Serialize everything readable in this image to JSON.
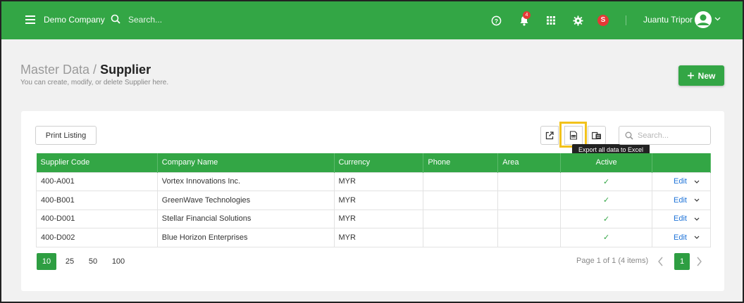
{
  "topbar": {
    "company": "Demo Company",
    "search_placeholder": "Search...",
    "notification_count": "4",
    "avatar_letter": "S",
    "username": "Juantu Tripor"
  },
  "colors": {
    "brand": "#33a645",
    "link": "#1e73d8",
    "highlight": "#f2c21b"
  },
  "page": {
    "breadcrumb_parent": "Master Data /",
    "title": "Supplier",
    "subtitle": "You can create, modify, or delete Supplier here.",
    "new_label": "New"
  },
  "toolbar": {
    "print_label": "Print Listing",
    "tooltip": "Export all data to Excel",
    "search_placeholder": "Search..."
  },
  "table": {
    "columns": [
      "Supplier Code",
      "Company Name",
      "Currency",
      "Phone",
      "Area",
      "Active",
      ""
    ],
    "rows": [
      {
        "code": "400-A001",
        "name": "Vortex Innovations Inc.",
        "currency": "MYR",
        "phone": "",
        "area": "",
        "edit": "Edit"
      },
      {
        "code": "400-B001",
        "name": "GreenWave Technologies",
        "currency": "MYR",
        "phone": "",
        "area": "",
        "edit": "Edit"
      },
      {
        "code": "400-D001",
        "name": "Stellar Financial Solutions",
        "currency": "MYR",
        "phone": "",
        "area": "",
        "edit": "Edit"
      },
      {
        "code": "400-D002",
        "name": "Blue Horizon Enterprises",
        "currency": "MYR",
        "phone": "",
        "area": "",
        "edit": "Edit"
      }
    ]
  },
  "pager": {
    "sizes": [
      "10",
      "25",
      "50",
      "100"
    ],
    "info": "Page 1 of 1 (4 items)",
    "current_page": "1"
  }
}
